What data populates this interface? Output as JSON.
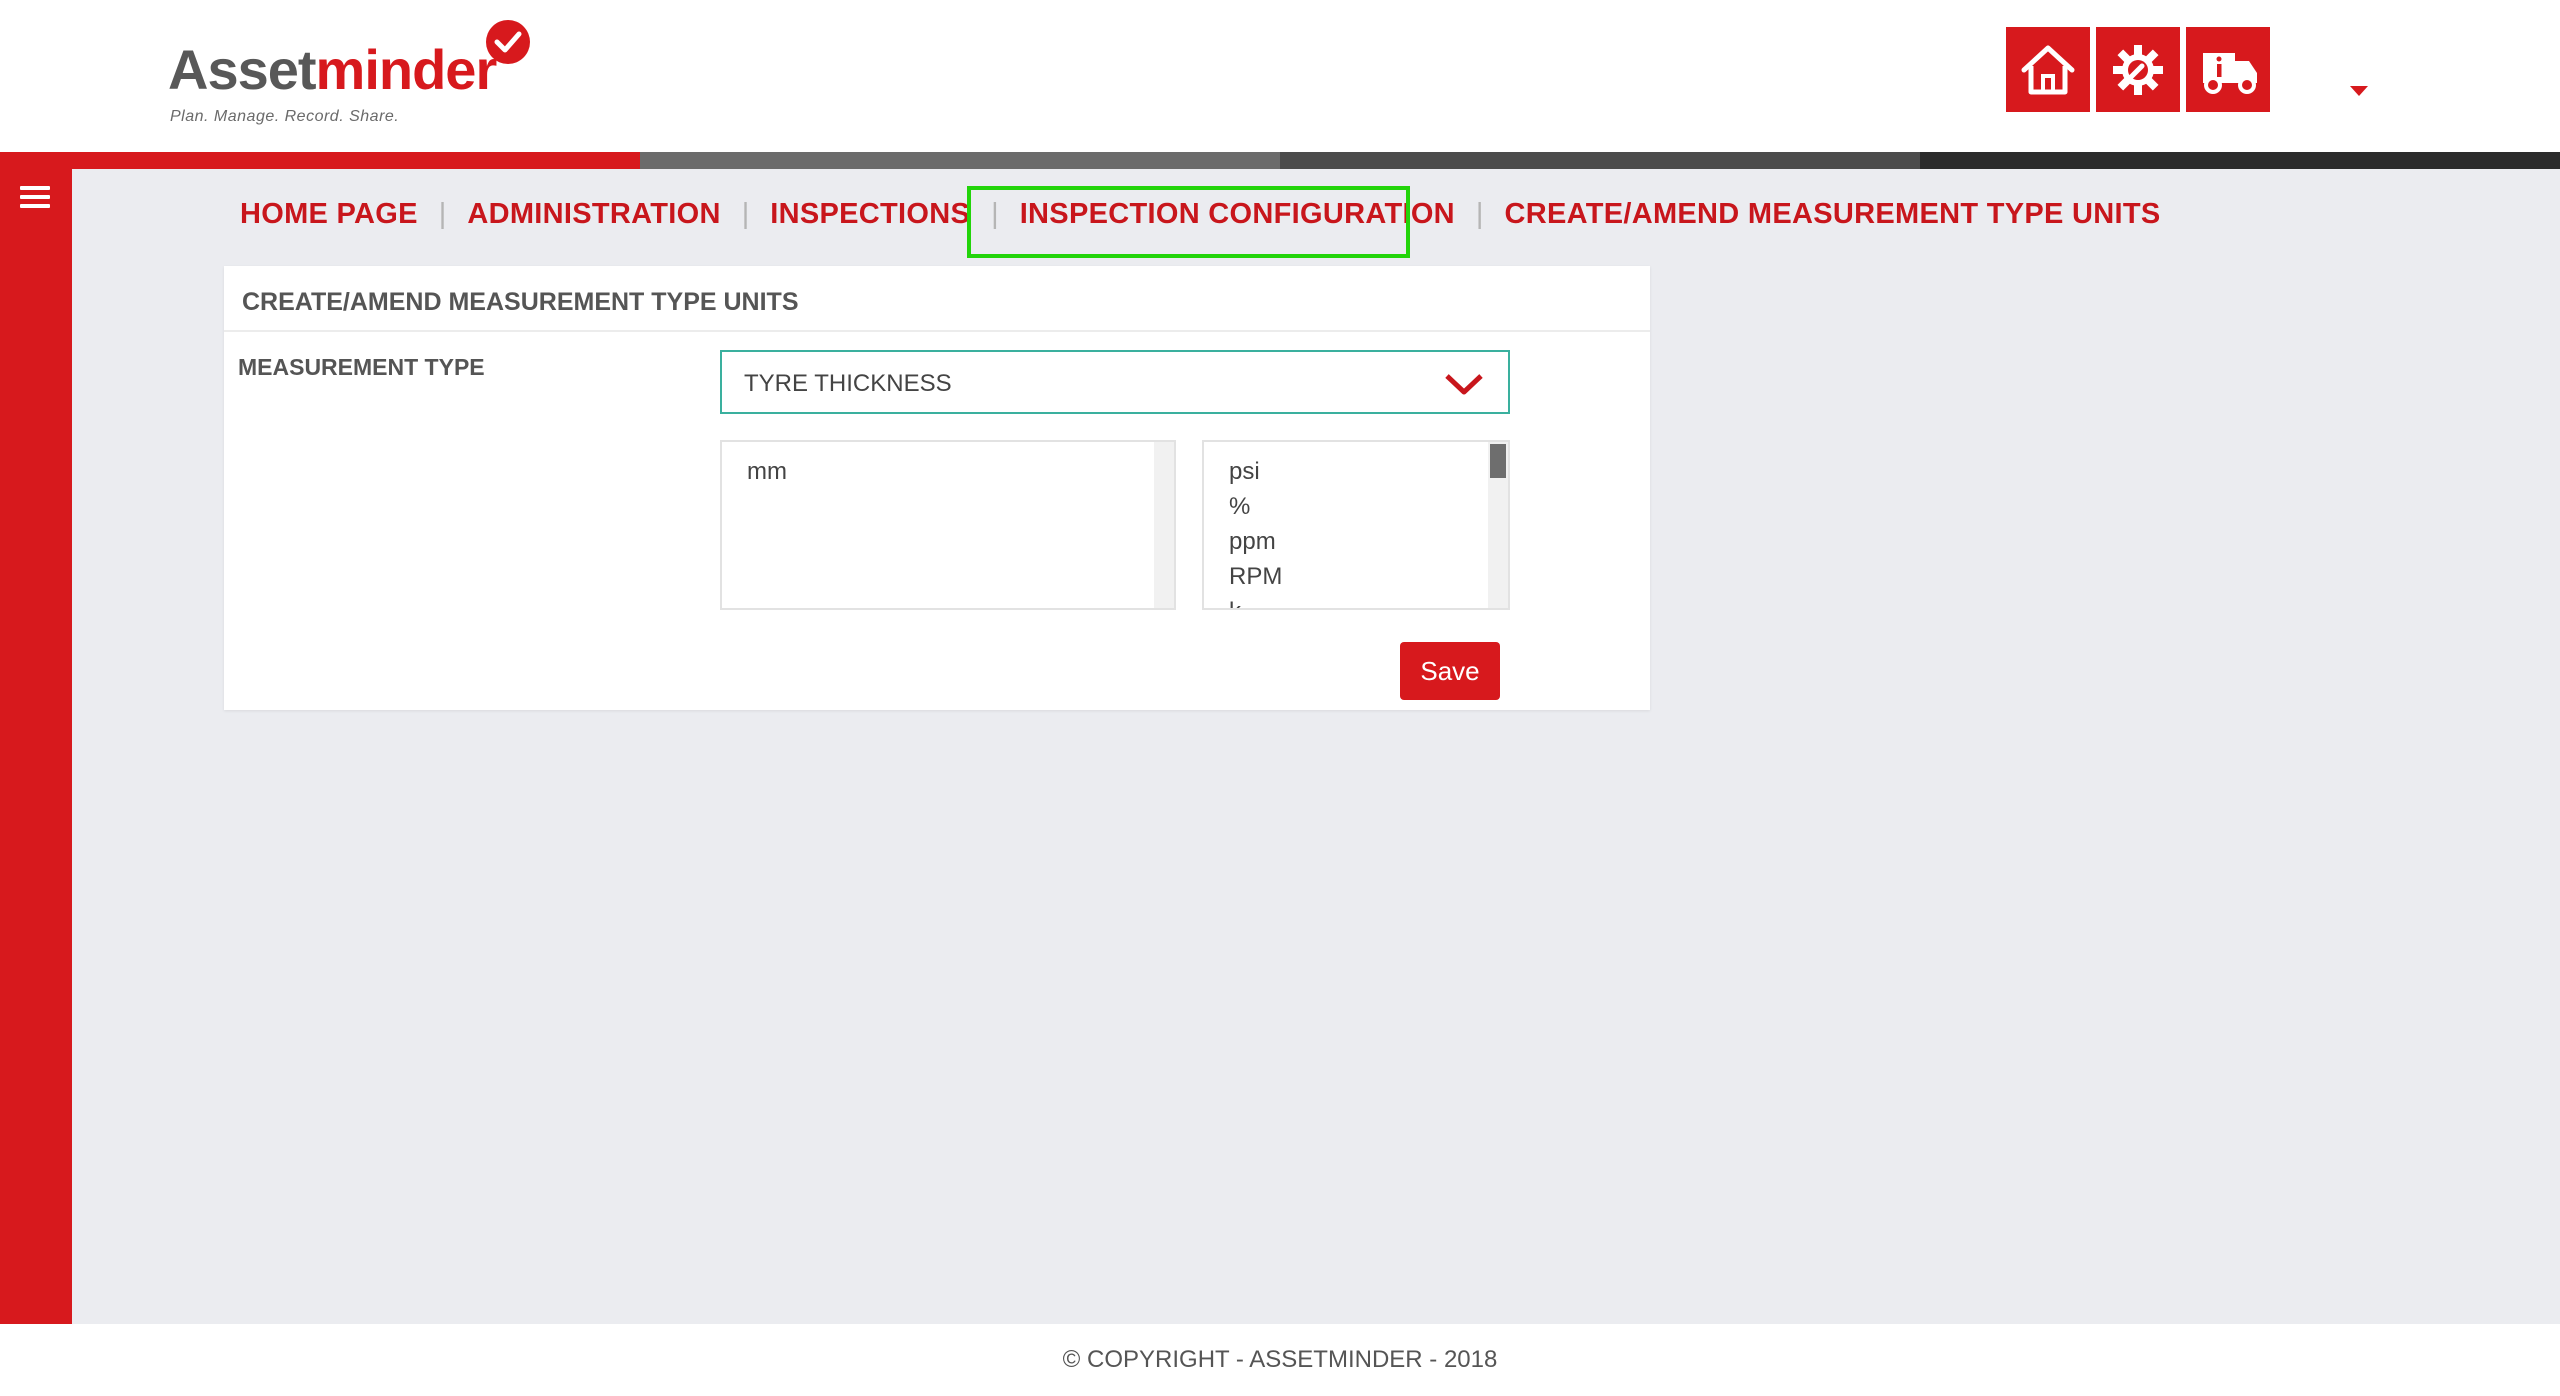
{
  "brand": {
    "name_part1": "Asset",
    "name_part2": "minder",
    "tagline": "Plan. Manage. Record. Share."
  },
  "header_icons": [
    {
      "name": "home-icon"
    },
    {
      "name": "settings-gear-icon"
    },
    {
      "name": "truck-info-icon"
    }
  ],
  "strip_colors": [
    "#d7191d",
    "#6b6b6b",
    "#4b4b4b",
    "#2b2b2b"
  ],
  "breadcrumb": [
    "HOME PAGE",
    "ADMINISTRATION",
    "INSPECTIONS",
    "INSPECTION CONFIGURATION",
    "CREATE/AMEND MEASUREMENT TYPE UNITS"
  ],
  "panel": {
    "title": "CREATE/AMEND MEASUREMENT TYPE UNITS",
    "field_label": "MEASUREMENT TYPE",
    "selected_type": "TYRE THICKNESS",
    "assigned_units": [
      "mm"
    ],
    "available_units": [
      "psi",
      "%",
      "ppm",
      "RPM",
      "k"
    ],
    "save_label": "Save"
  },
  "footer": {
    "copyright": "© COPYRIGHT - ASSETMINDER - 2018"
  },
  "colors": {
    "brand_red": "#d7191d",
    "highlight_green": "#22d40a",
    "select_border": "#3ab09e"
  }
}
